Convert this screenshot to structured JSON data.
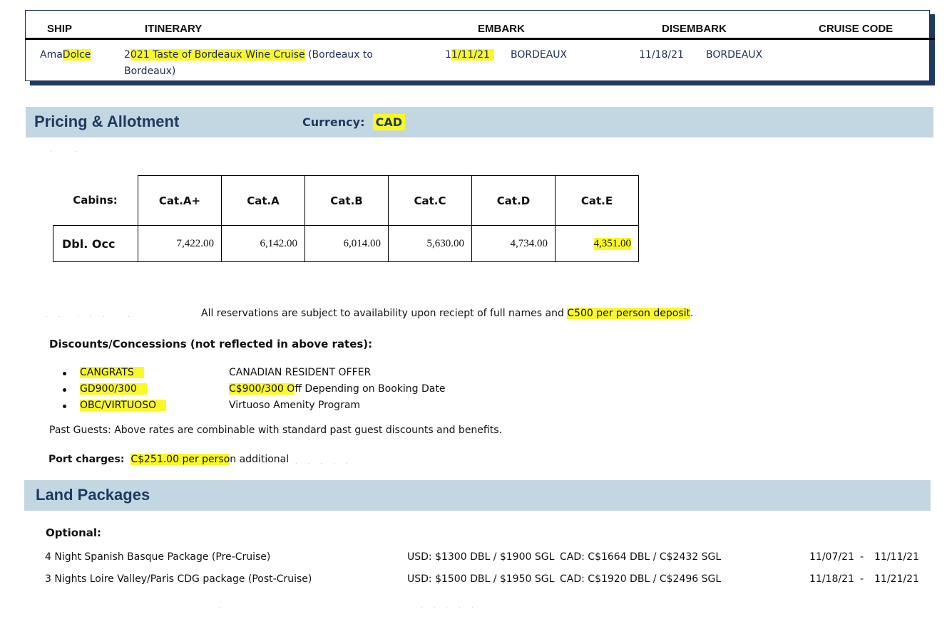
{
  "ship_table": {
    "headers": {
      "ship": "SHIP",
      "itinerary": "ITINERARY",
      "embark": "EMBARK",
      "disembark": "DISEMBARK",
      "cruise_code": "CRUISE CODE"
    },
    "row": {
      "ship_prefix": "Ama",
      "ship_highlight": "Dolce",
      "itinerary_prefix": "2",
      "itinerary_highlight": "021 Taste of Bordeaux Wine Cruise",
      "itinerary_rest_line1": " (Bordeaux to",
      "itinerary_rest_line2": "Bordeaux)",
      "embark_date_prefix": "1",
      "embark_date_highlight": "1/11/21",
      "embark_port": "BORDEAUX",
      "disembark_date": "11/18/21",
      "disembark_port": "BORDEAUX",
      "cruise_code": ""
    }
  },
  "pricing": {
    "title": "Pricing & Allotment",
    "currency_label": "Currency:",
    "currency_value": "CAD",
    "cabins_label": "Cabins:",
    "row_label": "Dbl. Occ",
    "categories": [
      "Cat.A+",
      "Cat.A",
      "Cat.B",
      "Cat.C",
      "Cat.D",
      "Cat.E"
    ],
    "prices": [
      "7,422.00",
      "6,142.00",
      "6,014.00",
      "5,630.00",
      "4,734.00",
      "4,351.00"
    ],
    "highlight_index": 5
  },
  "notes": {
    "reservation_prefix": "All reservations are subject to availability upon reciept of full names and ",
    "reservation_highlight": "C500 per person deposit",
    "reservation_suffix": ".",
    "discounts_title": "Discounts/Concessions (not reflected in above rates):",
    "discounts": [
      {
        "code": "CANGRATS",
        "desc_highlight": "",
        "desc": "CANADIAN RESIDENT OFFER"
      },
      {
        "code": "GD900/300",
        "desc_highlight": "C$900/300 O",
        "desc": "ff Depending on Booking Date"
      },
      {
        "code": "OBC/VIRTUOSO",
        "desc_highlight": "",
        "desc": "Virtuoso Amenity Program"
      }
    ],
    "past_guests": "Past Guests: Above rates are combinable with standard past guest discounts and benefits.",
    "port_label": "Port charges:",
    "port_highlight": "C$251.00  per perso",
    "port_rest": "n additional"
  },
  "land": {
    "title": "Land Packages",
    "optional_label": "Optional:",
    "packages": [
      {
        "name": "4 Night Spanish Basque Package (Pre-Cruise)",
        "usd": "USD: $1300 DBL / $1900 SGL",
        "cad": "CAD: C$1664 DBL / C$2432 SGL",
        "start": "11/07/21",
        "sep": "-",
        "end": "11/11/21"
      },
      {
        "name": "3 Nights Loire Valley/Paris CDG package (Post-Cruise)",
        "usd": "USD: $1500 DBL / $1950 SGL",
        "cad": "CAD: C$1920 DBL / C$2496 SGL",
        "start": "11/18/21",
        "sep": "-",
        "end": "11/21/21"
      }
    ]
  }
}
